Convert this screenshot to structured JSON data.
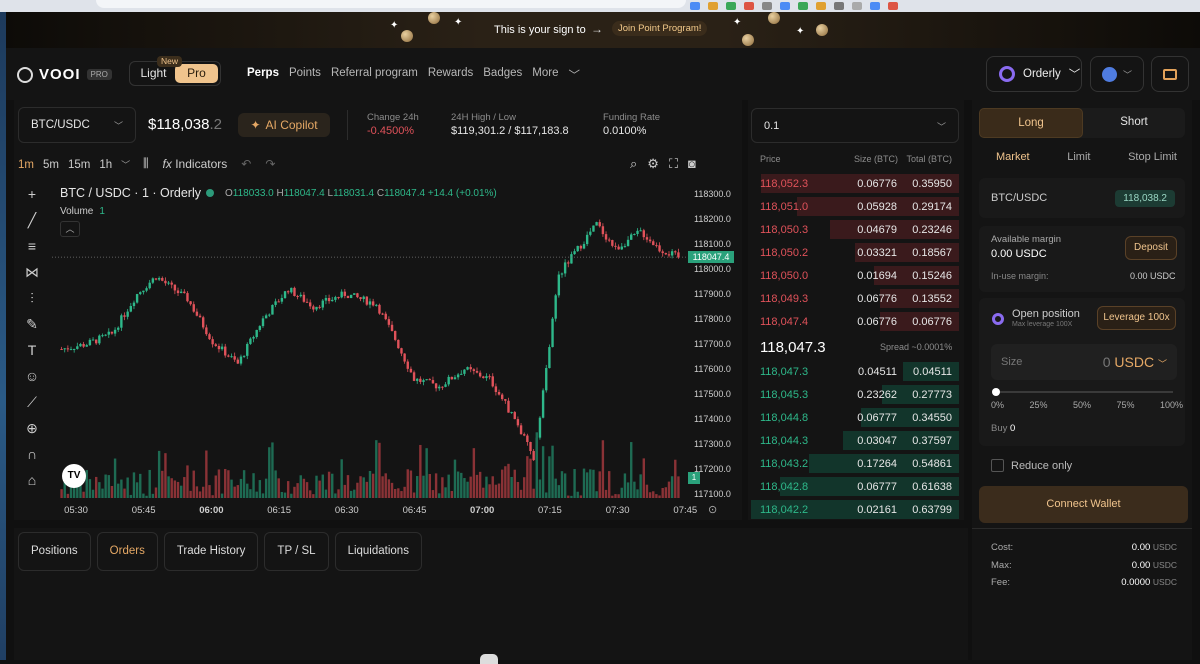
{
  "promo": {
    "text": "This is your sign to",
    "arrow": "→",
    "button": "Join Point Program!"
  },
  "brand": {
    "name": "VOOI",
    "badge": "PRO"
  },
  "mode": {
    "light": "Light",
    "pro": "Pro",
    "new_badge": "New"
  },
  "nav": {
    "items": [
      "Perps",
      "Points",
      "Referral program",
      "Rewards",
      "Badges",
      "More"
    ]
  },
  "account": {
    "name": "Orderly"
  },
  "market": {
    "pair": "BTC/USDC",
    "price_main": "$118,038",
    "price_dim": ".2",
    "copilot": "AI Copilot",
    "change_label": "Change 24h",
    "change_value": "-0.4500%",
    "hl_label": "24H High / Low",
    "hl_value": "$119,301.2 / $117,183.8",
    "funding_label": "Funding Rate",
    "funding_value": "0.0100%"
  },
  "toolbar": {
    "timeframes": [
      "1m",
      "5m",
      "15m",
      "1h"
    ],
    "indicators": "Indicators"
  },
  "legend": {
    "title": "BTC / USDC · 1 · Orderly",
    "o_label": "O",
    "o": "118033.0",
    "h_label": "H",
    "h": "118047.4",
    "l_label": "L",
    "l": "118031.4",
    "c_label": "C",
    "c": "118047.4",
    "chg": "+14.4 (+0.01%)",
    "volume_label": "Volume",
    "volume_value": "1"
  },
  "chart_data": {
    "type": "candlestick",
    "y_ticks": [
      "118300.0",
      "118200.0",
      "118100.0",
      "118000.0",
      "117900.0",
      "117800.0",
      "117700.0",
      "117600.0",
      "117500.0",
      "117400.0",
      "117300.0",
      "117200.0",
      "117100.0"
    ],
    "x_ticks": [
      "05:30",
      "05:45",
      "06:00",
      "06:15",
      "06:30",
      "06:45",
      "07:00",
      "07:15",
      "07:30",
      "07:45"
    ],
    "current_price": "118047.4",
    "volume_marker": "1",
    "ylim": [
      117100,
      118300
    ]
  },
  "orderbook": {
    "select": "0.1",
    "headers": [
      "Price",
      "Size (BTC)",
      "Total (BTC)"
    ],
    "asks": [
      {
        "p": "118,052.3",
        "s": "0.06776",
        "t": "0.35950",
        "d": 0.95
      },
      {
        "p": "118,051.0",
        "s": "0.05928",
        "t": "0.29174",
        "d": 0.78
      },
      {
        "p": "118,050.3",
        "s": "0.04679",
        "t": "0.23246",
        "d": 0.62
      },
      {
        "p": "118,050.2",
        "s": "0.03321",
        "t": "0.18567",
        "d": 0.5
      },
      {
        "p": "118,050.0",
        "s": "0.01694",
        "t": "0.15246",
        "d": 0.41
      },
      {
        "p": "118,049.3",
        "s": "0.06776",
        "t": "0.13552",
        "d": 0.38
      },
      {
        "p": "118,047.4",
        "s": "0.06776",
        "t": "0.06776",
        "d": 0.38
      }
    ],
    "mid": "118,047.3",
    "spread": "Spread ~0.0001%",
    "bids": [
      {
        "p": "118,047.3",
        "s": "0.04511",
        "t": "0.04511",
        "d": 0.27
      },
      {
        "p": "118,045.3",
        "s": "0.23262",
        "t": "0.27773",
        "d": 0.37
      },
      {
        "p": "118,044.8",
        "s": "0.06777",
        "t": "0.34550",
        "d": 0.47
      },
      {
        "p": "118,044.3",
        "s": "0.03047",
        "t": "0.37597",
        "d": 0.56
      },
      {
        "p": "118,043.2",
        "s": "0.17264",
        "t": "0.54861",
        "d": 0.72
      },
      {
        "p": "118,042.8",
        "s": "0.06777",
        "t": "0.61638",
        "d": 0.86
      },
      {
        "p": "118,042.2",
        "s": "0.02161",
        "t": "0.63799",
        "d": 1.0
      }
    ]
  },
  "trade": {
    "long": "Long",
    "short": "Short",
    "order_types": [
      "Market",
      "Limit",
      "Stop Limit"
    ],
    "pair": "BTC/USDC",
    "pair_price": "118,038.2",
    "available_label": "Available margin",
    "available_value": "0.00 USDC",
    "deposit": "Deposit",
    "inuse_label": "In-use margin:",
    "inuse_value": "0.00 USDC",
    "open_position": "Open position",
    "max_leverage": "Max leverage 100X",
    "leverage": "Leverage 100x",
    "size_label": "Size",
    "size_value": "0",
    "size_unit": "USDC",
    "pcts": [
      "0%",
      "25%",
      "50%",
      "75%",
      "100%"
    ],
    "buy_label": "Buy",
    "buy_value": "0",
    "reduce_only": "Reduce only",
    "connect": "Connect Wallet",
    "cost_label": "Cost:",
    "cost_value": "0.00",
    "max_label": "Max:",
    "max_value": "0.00",
    "fee_label": "Fee:",
    "fee_value": "0.0000",
    "unit": "USDC"
  },
  "bottom_tabs": [
    "Positions",
    "Orders",
    "Trade History",
    "TP / SL",
    "Liquidations"
  ]
}
